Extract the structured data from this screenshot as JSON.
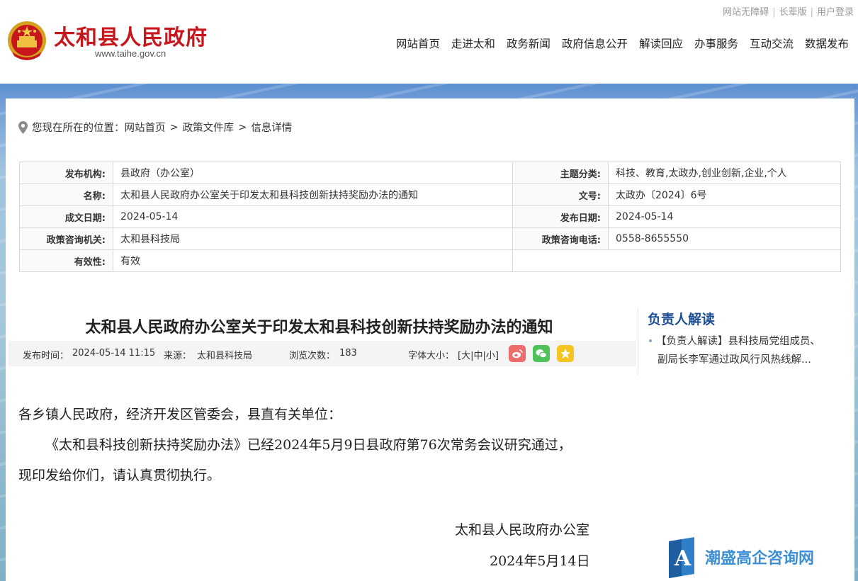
{
  "header": {
    "site_title": "太和县人民政府",
    "site_url": "www.taihe.gov.cn",
    "top_links": [
      "网站无障碍",
      "长辈版",
      "用户登录"
    ],
    "nav": [
      "网站首页",
      "走进太和",
      "政务新闻",
      "政府信息公开",
      "解读回应",
      "办事服务",
      "互动交流",
      "数据发布"
    ]
  },
  "breadcrumb": {
    "prefix": "您现在所在的位置：",
    "items": [
      "网站首页",
      "政策文件库",
      "信息详情"
    ],
    "separator": ">"
  },
  "info": {
    "rows": [
      {
        "k1": "发布机构:",
        "v1": "县政府（办公室）",
        "k2": "主题分类:",
        "v2": "科技、教育,太政办,创业创新,企业,个人"
      },
      {
        "k1": "名称:",
        "v1": "太和县人民政府办公室关于印发太和县科技创新扶持奖励办法的通知",
        "k2": "文号:",
        "v2": "太政办〔2024〕6号"
      },
      {
        "k1": "成文日期:",
        "v1": "2024-05-14",
        "k2": "发布日期:",
        "v2": "2024-05-14"
      },
      {
        "k1": "政策咨询机关:",
        "v1": "太和县科技局",
        "k2": "政策咨询电话:",
        "v2": "0558-8655550"
      },
      {
        "k1": "有效性:",
        "v1": "有效",
        "k2": "",
        "v2": ""
      }
    ]
  },
  "article": {
    "title": "太和县人民政府办公室关于印发太和县科技创新扶持奖励办法的通知",
    "meta": {
      "publish_label": "发布时间：",
      "publish_time": "2024-05-14 11:15",
      "source_label": "来源：",
      "source": "太和县科技局",
      "views_label": "浏览次数：",
      "views": "183",
      "font_size_label": "字体大小：",
      "font_sizes": "[大|中|小]"
    },
    "paragraphs": [
      "各乡镇人民政府，经济开发区管委会，县直有关单位：",
      "《太和县科技创新扶持奖励办法》已经2024年5月9日县政府第76次常务会议研究通过，",
      "现印发给你们，请认真贯彻执行。"
    ],
    "signature": "太和县人民政府办公室",
    "sign_date": "2024年5月14日"
  },
  "sidebar": {
    "title": "负责人解读",
    "item_line1": "【负责人解读】县科技局党组成员、",
    "item_line2": "副局长李军通过政风行风热线解..."
  },
  "share_icons": [
    "weibo-icon",
    "wechat-icon",
    "favorite-icon"
  ],
  "watermark": {
    "text": "潮盛高企咨询网",
    "letter": "A"
  },
  "colors": {
    "brand_red": "#c8161d",
    "sidebar_blue": "#1f4f93",
    "band_blue": "#6d9ad6"
  }
}
